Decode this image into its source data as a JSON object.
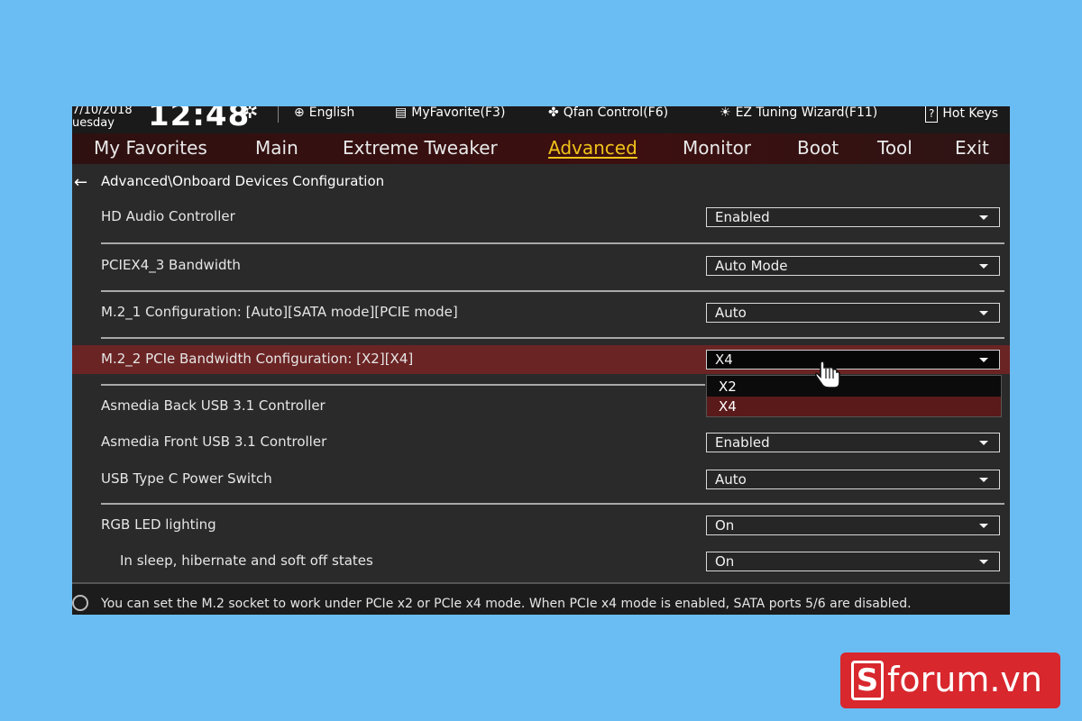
{
  "topbar": {
    "date": "7/10/2018",
    "day": "uesday",
    "time": "12:48",
    "tools": [
      {
        "icon": "globe-icon",
        "glyph": "🌐",
        "label": "English"
      },
      {
        "icon": "favorites-list-icon",
        "glyph": "▤",
        "label": "MyFavorite(F3)"
      },
      {
        "icon": "fan-icon",
        "glyph": "✤",
        "label": "Qfan Control(F6)"
      },
      {
        "icon": "bulb-icon",
        "glyph": "☀",
        "label": "EZ Tuning Wizard(F11)"
      },
      {
        "icon": "help-icon",
        "glyph": "?",
        "label": "Hot Keys"
      }
    ]
  },
  "menu": {
    "items": [
      "My Favorites",
      "Main",
      "Extreme Tweaker",
      "Advanced",
      "Monitor",
      "Boot",
      "Tool",
      "Exit"
    ],
    "active": "Advanced"
  },
  "breadcrumb": "Advanced\\Onboard Devices Configuration",
  "settings": [
    {
      "label": "HD Audio Controller",
      "value": "Enabled"
    },
    {
      "label": "PCIEX4_3 Bandwidth",
      "value": "Auto Mode"
    },
    {
      "label": "M.2_1 Configuration: [Auto][SATA mode][PCIE mode]",
      "value": "Auto"
    },
    {
      "label": "M.2_2 PCIe Bandwidth Configuration: [X2][X4]",
      "value": "X4"
    },
    {
      "label": "Asmedia Back USB 3.1 Controller",
      "value": ""
    },
    {
      "label": "Asmedia Front USB 3.1 Controller",
      "value": "Enabled"
    },
    {
      "label": "USB Type C Power Switch",
      "value": "Auto"
    },
    {
      "label": "RGB LED lighting",
      "value": "On"
    },
    {
      "label": "In sleep, hibernate and soft off states",
      "value": "On"
    }
  ],
  "dropdown": {
    "options": [
      "X2",
      "X4"
    ],
    "selected": "X4"
  },
  "help_text": "You can set the M.2 socket to work under PCIe x2 or PCIe x4 mode. When PCIe x4 mode is enabled, SATA ports 5/6 are disabled.",
  "logo": {
    "letter": "S",
    "text": "forum.vn"
  },
  "colors": {
    "accent": "#f0c419",
    "highlight": "#6b2424",
    "background": "#6abdf3",
    "logo": "#d8272d"
  }
}
